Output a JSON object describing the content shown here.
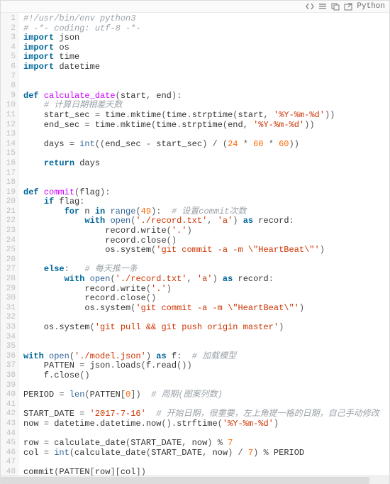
{
  "toolbar": {
    "icons": {
      "code": "code-icon",
      "menu": "menu-icon",
      "copy": "copy-icon",
      "newwin": "newwin-icon"
    },
    "language_label": "Python"
  },
  "line_count": 48,
  "code_lines": [
    [
      [
        "cm",
        "#!/usr/bin/env python3"
      ]
    ],
    [
      [
        "cm",
        "# -*- coding: utf-8 -*-"
      ]
    ],
    [
      [
        "kw",
        "import"
      ],
      [
        "nm",
        " json"
      ]
    ],
    [
      [
        "kw",
        "import"
      ],
      [
        "nm",
        " os"
      ]
    ],
    [
      [
        "kw",
        "import"
      ],
      [
        "nm",
        " time"
      ]
    ],
    [
      [
        "kw",
        "import"
      ],
      [
        "nm",
        " datetime"
      ]
    ],
    [],
    [],
    [
      [
        "kw",
        "def"
      ],
      [
        "nm",
        " "
      ],
      [
        "fn",
        "calculate_date"
      ],
      [
        "pn",
        "("
      ],
      [
        "nm",
        "start"
      ],
      [
        "pn",
        ","
      ],
      [
        "nm",
        " end"
      ],
      [
        "pn",
        ")"
      ],
      [
        "pn",
        ":"
      ]
    ],
    [
      [
        "nm",
        "    "
      ],
      [
        "cm",
        "# 计算日期相差天数"
      ]
    ],
    [
      [
        "nm",
        "    start_sec "
      ],
      [
        "op",
        "="
      ],
      [
        "nm",
        " time"
      ],
      [
        "pn",
        "."
      ],
      [
        "nm",
        "mktime"
      ],
      [
        "pn",
        "("
      ],
      [
        "nm",
        "time"
      ],
      [
        "pn",
        "."
      ],
      [
        "nm",
        "strptime"
      ],
      [
        "pn",
        "("
      ],
      [
        "nm",
        "start"
      ],
      [
        "pn",
        ","
      ],
      [
        "nm",
        " "
      ],
      [
        "st",
        "'%Y-%m-%d'"
      ],
      [
        "pn",
        "))"
      ]
    ],
    [
      [
        "nm",
        "    end_sec "
      ],
      [
        "op",
        "="
      ],
      [
        "nm",
        " time"
      ],
      [
        "pn",
        "."
      ],
      [
        "nm",
        "mktime"
      ],
      [
        "pn",
        "("
      ],
      [
        "nm",
        "time"
      ],
      [
        "pn",
        "."
      ],
      [
        "nm",
        "strptime"
      ],
      [
        "pn",
        "("
      ],
      [
        "nm",
        "end"
      ],
      [
        "pn",
        ","
      ],
      [
        "nm",
        " "
      ],
      [
        "st",
        "'%Y-%m-%d'"
      ],
      [
        "pn",
        "))"
      ]
    ],
    [],
    [
      [
        "nm",
        "    days "
      ],
      [
        "op",
        "="
      ],
      [
        "nm",
        " "
      ],
      [
        "bi",
        "int"
      ],
      [
        "pn",
        "(("
      ],
      [
        "nm",
        "end_sec "
      ],
      [
        "op",
        "-"
      ],
      [
        "nm",
        " start_sec"
      ],
      [
        "pn",
        ")"
      ],
      [
        "nm",
        " "
      ],
      [
        "op",
        "/"
      ],
      [
        "nm",
        " "
      ],
      [
        "pn",
        "("
      ],
      [
        "nu",
        "24"
      ],
      [
        "nm",
        " "
      ],
      [
        "op",
        "*"
      ],
      [
        "nm",
        " "
      ],
      [
        "nu",
        "60"
      ],
      [
        "nm",
        " "
      ],
      [
        "op",
        "*"
      ],
      [
        "nm",
        " "
      ],
      [
        "nu",
        "60"
      ],
      [
        "pn",
        "))"
      ]
    ],
    [],
    [
      [
        "nm",
        "    "
      ],
      [
        "kw",
        "return"
      ],
      [
        "nm",
        " days"
      ]
    ],
    [],
    [],
    [
      [
        "kw",
        "def"
      ],
      [
        "nm",
        " "
      ],
      [
        "fn",
        "commit"
      ],
      [
        "pn",
        "("
      ],
      [
        "nm",
        "flag"
      ],
      [
        "pn",
        ")"
      ],
      [
        "pn",
        ":"
      ]
    ],
    [
      [
        "nm",
        "    "
      ],
      [
        "kw",
        "if"
      ],
      [
        "nm",
        " flag"
      ],
      [
        "pn",
        ":"
      ]
    ],
    [
      [
        "nm",
        "        "
      ],
      [
        "kw",
        "for"
      ],
      [
        "nm",
        " n "
      ],
      [
        "kw",
        "in"
      ],
      [
        "nm",
        " "
      ],
      [
        "bi",
        "range"
      ],
      [
        "pn",
        "("
      ],
      [
        "nu",
        "49"
      ],
      [
        "pn",
        ")"
      ],
      [
        "pn",
        ":"
      ],
      [
        "nm",
        "  "
      ],
      [
        "cm",
        "# 设置commit次数"
      ]
    ],
    [
      [
        "nm",
        "            "
      ],
      [
        "kw",
        "with"
      ],
      [
        "nm",
        " "
      ],
      [
        "bi",
        "open"
      ],
      [
        "pn",
        "("
      ],
      [
        "st",
        "'./record.txt'"
      ],
      [
        "pn",
        ","
      ],
      [
        "nm",
        " "
      ],
      [
        "st",
        "'a'"
      ],
      [
        "pn",
        ")"
      ],
      [
        "nm",
        " "
      ],
      [
        "kw",
        "as"
      ],
      [
        "nm",
        " record"
      ],
      [
        "pn",
        ":"
      ]
    ],
    [
      [
        "nm",
        "                record"
      ],
      [
        "pn",
        "."
      ],
      [
        "nm",
        "write"
      ],
      [
        "pn",
        "("
      ],
      [
        "st",
        "'.'"
      ],
      [
        "pn",
        ")"
      ]
    ],
    [
      [
        "nm",
        "                record"
      ],
      [
        "pn",
        "."
      ],
      [
        "nm",
        "close"
      ],
      [
        "pn",
        "()"
      ]
    ],
    [
      [
        "nm",
        "                os"
      ],
      [
        "pn",
        "."
      ],
      [
        "nm",
        "system"
      ],
      [
        "pn",
        "("
      ],
      [
        "st",
        "'git commit -a -m \\\"HeartBeat\\\"'"
      ],
      [
        "pn",
        ")"
      ]
    ],
    [],
    [
      [
        "nm",
        "    "
      ],
      [
        "kw",
        "else"
      ],
      [
        "pn",
        ":"
      ],
      [
        "nm",
        "   "
      ],
      [
        "cm",
        "# 每天推一条"
      ]
    ],
    [
      [
        "nm",
        "        "
      ],
      [
        "kw",
        "with"
      ],
      [
        "nm",
        " "
      ],
      [
        "bi",
        "open"
      ],
      [
        "pn",
        "("
      ],
      [
        "st",
        "'./record.txt'"
      ],
      [
        "pn",
        ","
      ],
      [
        "nm",
        " "
      ],
      [
        "st",
        "'a'"
      ],
      [
        "pn",
        ")"
      ],
      [
        "nm",
        " "
      ],
      [
        "kw",
        "as"
      ],
      [
        "nm",
        " record"
      ],
      [
        "pn",
        ":"
      ]
    ],
    [
      [
        "nm",
        "            record"
      ],
      [
        "pn",
        "."
      ],
      [
        "nm",
        "write"
      ],
      [
        "pn",
        "("
      ],
      [
        "st",
        "'.'"
      ],
      [
        "pn",
        ")"
      ]
    ],
    [
      [
        "nm",
        "            record"
      ],
      [
        "pn",
        "."
      ],
      [
        "nm",
        "close"
      ],
      [
        "pn",
        "()"
      ]
    ],
    [
      [
        "nm",
        "            os"
      ],
      [
        "pn",
        "."
      ],
      [
        "nm",
        "system"
      ],
      [
        "pn",
        "("
      ],
      [
        "st",
        "'git commit -a -m \\\"HeartBeat\\\"'"
      ],
      [
        "pn",
        ")"
      ]
    ],
    [],
    [
      [
        "nm",
        "    os"
      ],
      [
        "pn",
        "."
      ],
      [
        "nm",
        "system"
      ],
      [
        "pn",
        "("
      ],
      [
        "st",
        "'git pull && git push origin master'"
      ],
      [
        "pn",
        ")"
      ]
    ],
    [],
    [],
    [
      [
        "kw",
        "with"
      ],
      [
        "nm",
        " "
      ],
      [
        "bi",
        "open"
      ],
      [
        "pn",
        "("
      ],
      [
        "st",
        "'./model.json'"
      ],
      [
        "pn",
        ")"
      ],
      [
        "nm",
        " "
      ],
      [
        "kw",
        "as"
      ],
      [
        "nm",
        " f"
      ],
      [
        "pn",
        ":"
      ],
      [
        "nm",
        "  "
      ],
      [
        "cm",
        "# 加载模型"
      ]
    ],
    [
      [
        "nm",
        "    PATTEN "
      ],
      [
        "op",
        "="
      ],
      [
        "nm",
        " json"
      ],
      [
        "pn",
        "."
      ],
      [
        "nm",
        "loads"
      ],
      [
        "pn",
        "("
      ],
      [
        "nm",
        "f"
      ],
      [
        "pn",
        "."
      ],
      [
        "nm",
        "read"
      ],
      [
        "pn",
        "())"
      ]
    ],
    [
      [
        "nm",
        "    f"
      ],
      [
        "pn",
        "."
      ],
      [
        "nm",
        "close"
      ],
      [
        "pn",
        "()"
      ]
    ],
    [],
    [
      [
        "nm",
        "PERIOD "
      ],
      [
        "op",
        "="
      ],
      [
        "nm",
        " "
      ],
      [
        "bi",
        "len"
      ],
      [
        "pn",
        "("
      ],
      [
        "nm",
        "PATTEN"
      ],
      [
        "pn",
        "["
      ],
      [
        "nu",
        "0"
      ],
      [
        "pn",
        "])"
      ],
      [
        "nm",
        "  "
      ],
      [
        "cm",
        "# 周期(图案列数)"
      ]
    ],
    [],
    [
      [
        "nm",
        "START_DATE "
      ],
      [
        "op",
        "="
      ],
      [
        "nm",
        " "
      ],
      [
        "st",
        "'2017-7-16'"
      ],
      [
        "nm",
        "  "
      ],
      [
        "cm",
        "# 开始日期，很重要，左上角提一格的日期，自己手动修改"
      ]
    ],
    [
      [
        "nm",
        "now "
      ],
      [
        "op",
        "="
      ],
      [
        "nm",
        " datetime"
      ],
      [
        "pn",
        "."
      ],
      [
        "nm",
        "datetime"
      ],
      [
        "pn",
        "."
      ],
      [
        "nm",
        "now"
      ],
      [
        "pn",
        "()"
      ],
      [
        "pn",
        "."
      ],
      [
        "nm",
        "strftime"
      ],
      [
        "pn",
        "("
      ],
      [
        "st",
        "'%Y-%m-%d'"
      ],
      [
        "pn",
        ")"
      ]
    ],
    [],
    [
      [
        "nm",
        "row "
      ],
      [
        "op",
        "="
      ],
      [
        "nm",
        " calculate_date"
      ],
      [
        "pn",
        "("
      ],
      [
        "nm",
        "START_DATE"
      ],
      [
        "pn",
        ","
      ],
      [
        "nm",
        " now"
      ],
      [
        "pn",
        ")"
      ],
      [
        "nm",
        " "
      ],
      [
        "op",
        "%"
      ],
      [
        "nm",
        " "
      ],
      [
        "nu",
        "7"
      ]
    ],
    [
      [
        "nm",
        "col "
      ],
      [
        "op",
        "="
      ],
      [
        "nm",
        " "
      ],
      [
        "bi",
        "int"
      ],
      [
        "pn",
        "("
      ],
      [
        "nm",
        "calculate_date"
      ],
      [
        "pn",
        "("
      ],
      [
        "nm",
        "START_DATE"
      ],
      [
        "pn",
        ","
      ],
      [
        "nm",
        " now"
      ],
      [
        "pn",
        ")"
      ],
      [
        "nm",
        " "
      ],
      [
        "op",
        "/"
      ],
      [
        "nm",
        " "
      ],
      [
        "nu",
        "7"
      ],
      [
        "pn",
        ")"
      ],
      [
        "nm",
        " "
      ],
      [
        "op",
        "%"
      ],
      [
        "nm",
        " PERIOD"
      ]
    ],
    [],
    [
      [
        "nm",
        "commit"
      ],
      [
        "pn",
        "("
      ],
      [
        "nm",
        "PATTEN"
      ],
      [
        "pn",
        "["
      ],
      [
        "nm",
        "row"
      ],
      [
        "pn",
        "]["
      ],
      [
        "nm",
        "col"
      ],
      [
        "pn",
        "])"
      ]
    ]
  ]
}
